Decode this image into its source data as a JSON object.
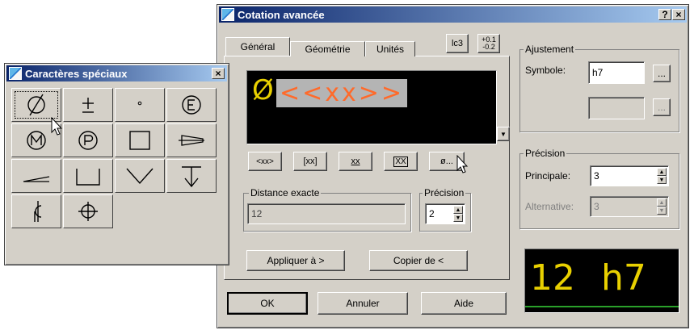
{
  "main_dialog": {
    "title": "Cotation avancée",
    "help_btn": "?",
    "close_btn": "×",
    "tabs": [
      "Général",
      "Géométrie",
      "Unités"
    ],
    "toolbar_icons": [
      "lc3",
      "+0.1",
      "-0.2"
    ],
    "preview_diameter": "Ø",
    "preview_text": "<<xx>>",
    "format_buttons": [
      "<xx>",
      "[xx]",
      "xx",
      "XX",
      "ø..."
    ],
    "distance": {
      "label": "Distance exacte",
      "value": "12"
    },
    "precision_small": {
      "label": "Précision",
      "value": "2"
    },
    "apply_btn": "Appliquer à >",
    "copy_btn": "Copier de <",
    "ok_btn": "OK",
    "cancel_btn": "Annuler",
    "help_text_btn": "Aide",
    "adjustment": {
      "label": "Ajustement",
      "symbol_label": "Symbole:",
      "symbol_value": "h7",
      "browse": "..."
    },
    "precision": {
      "label": "Précision",
      "main_label": "Principale:",
      "main_value": "3",
      "alt_label": "Alternative:",
      "alt_value": "3"
    },
    "result_preview": "12 h7"
  },
  "special_chars": {
    "title": "Caractères spéciaux",
    "close_btn": "×",
    "symbols": [
      "diameter-icon",
      "plus-minus-icon",
      "degree-icon",
      "circle-e-icon",
      "circle-m-icon",
      "circle-p-icon",
      "square-icon",
      "conical-icon",
      "slope-icon",
      "counterbore-icon",
      "countersink-icon",
      "depth-icon",
      "centerline-icon",
      "position-icon"
    ]
  },
  "colors": {
    "preview_red": "#ff6a2a",
    "preview_yellow": "#e8d000",
    "title_blue": "#0a246a"
  }
}
